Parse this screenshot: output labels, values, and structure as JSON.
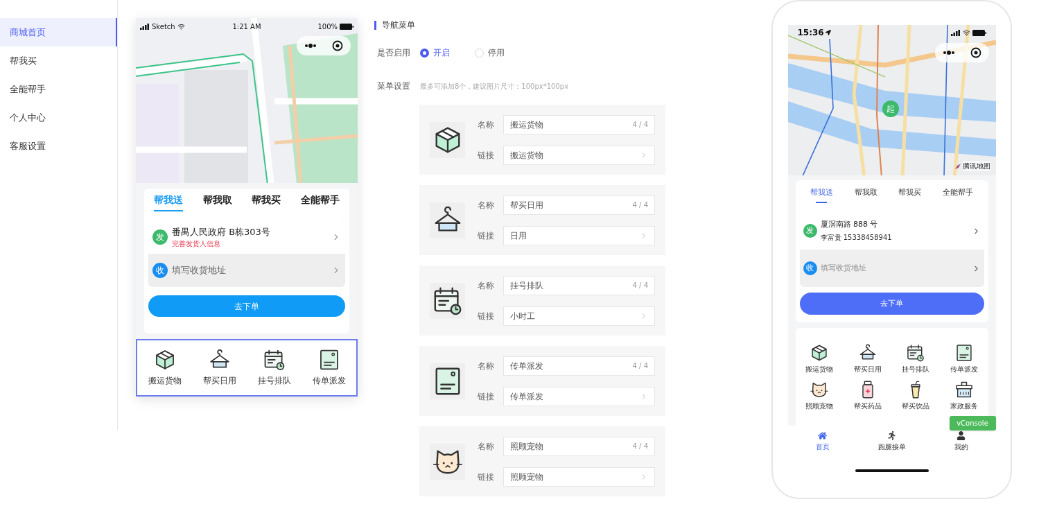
{
  "sidebar": {
    "items": [
      {
        "label": "商城首页",
        "selected": true
      },
      {
        "label": "帮我买",
        "selected": false
      },
      {
        "label": "全能帮手",
        "selected": false
      },
      {
        "label": "个人中心",
        "selected": false
      },
      {
        "label": "客服设置",
        "selected": false
      }
    ]
  },
  "preview": {
    "status_bar": {
      "carrier": "Sketch",
      "time": "1:21 AM",
      "battery": "100%"
    },
    "tabs": [
      {
        "label": "帮我送",
        "selected": true
      },
      {
        "label": "帮我取",
        "selected": false
      },
      {
        "label": "帮我买",
        "selected": false
      },
      {
        "label": "全能帮手",
        "selected": false
      }
    ],
    "sender": {
      "badge": "发",
      "address": "番禺人民政府 B栋303号",
      "hint": "完善发货人信息"
    },
    "receiver": {
      "badge": "收",
      "placeholder": "填写收货地址"
    },
    "order_button": "去下单",
    "menu": {
      "selected": true,
      "items": [
        {
          "label": "搬运货物"
        },
        {
          "label": "帮买日用"
        },
        {
          "label": "挂号排队"
        },
        {
          "label": "传单派发"
        }
      ]
    }
  },
  "settings": {
    "title": "导航菜单",
    "enable": {
      "label": "是否启用",
      "options": [
        {
          "label": "开启",
          "selected": true
        },
        {
          "label": "停用",
          "selected": false
        }
      ]
    },
    "menu_setting": {
      "label": "菜单设置",
      "hint": "最多可添加8个，建议图片尺寸：100px*100px"
    },
    "items": [
      {
        "name_label": "名称",
        "name": "搬运货物",
        "count": "4 / 4",
        "link_label": "链接",
        "link": "搬运货物"
      },
      {
        "name_label": "名称",
        "name": "帮买日用",
        "count": "4 / 4",
        "link_label": "链接",
        "link": "日用"
      },
      {
        "name_label": "名称",
        "name": "挂号排队",
        "count": "4 / 4",
        "link_label": "链接",
        "link": "小时工"
      },
      {
        "name_label": "名称",
        "name": "传单派发",
        "count": "4 / 4",
        "link_label": "链接",
        "link": "传单派发"
      },
      {
        "name_label": "名称",
        "name": "照顾宠物",
        "count": "4 / 4",
        "link_label": "链接",
        "link": "照顾宠物"
      }
    ]
  },
  "phone": {
    "status_bar": {
      "time": "15:36"
    },
    "start_marker": "起",
    "map_credit": "腾讯地图",
    "tabs": [
      {
        "label": "帮我送",
        "selected": true
      },
      {
        "label": "帮我取",
        "selected": false
      },
      {
        "label": "帮我买",
        "selected": false
      },
      {
        "label": "全能帮手",
        "selected": false
      }
    ],
    "sender": {
      "badge": "发",
      "address": "厦滘南路 888 号",
      "contact": "李富贵 15338458941"
    },
    "receiver": {
      "badge": "收",
      "placeholder": "填写收货地址"
    },
    "order_button": "去下单",
    "menu": [
      {
        "label": "搬运货物"
      },
      {
        "label": "帮买日用"
      },
      {
        "label": "挂号排队"
      },
      {
        "label": "传单派发"
      },
      {
        "label": "照顾宠物"
      },
      {
        "label": "帮买药品"
      },
      {
        "label": "帮买饮品"
      },
      {
        "label": "家政服务"
      }
    ],
    "tab_bar": [
      {
        "label": "首页",
        "selected": true
      },
      {
        "label": "跑腿接单",
        "selected": false
      },
      {
        "label": "我的",
        "selected": false
      }
    ],
    "vconsole": "vConsole"
  }
}
